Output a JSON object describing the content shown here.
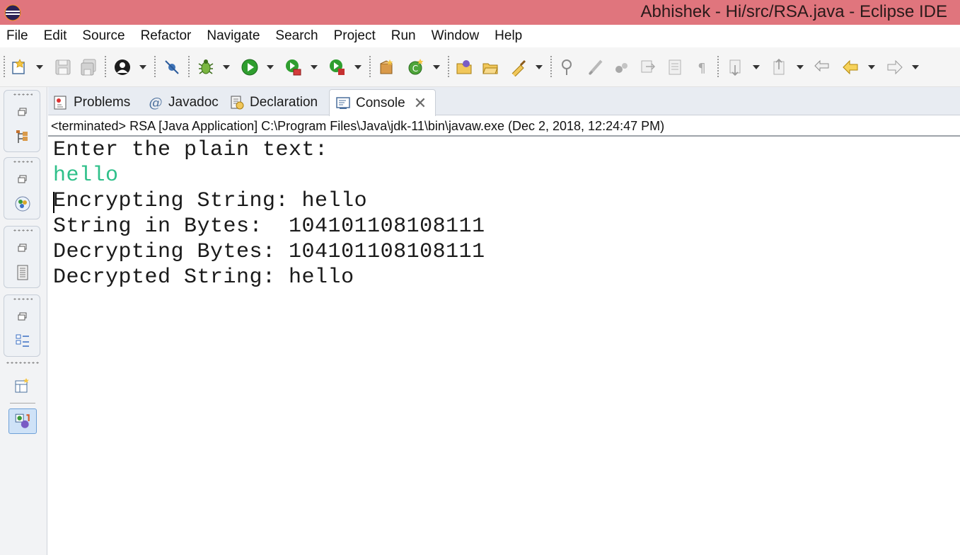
{
  "window": {
    "title": "Abhishek - Hi/src/RSA.java - Eclipse IDE"
  },
  "menu": [
    "File",
    "Edit",
    "Source",
    "Refactor",
    "Navigate",
    "Search",
    "Project",
    "Run",
    "Window",
    "Help"
  ],
  "toolbar_icons": [
    "new-icon",
    "save-icon",
    "save-all-icon",
    "profile-icon",
    "skip-breakpoints-icon",
    "debug-icon",
    "run-icon",
    "coverage-icon",
    "external-tools-icon",
    "new-java-package-icon",
    "new-java-class-icon",
    "open-type-icon",
    "open-task-icon",
    "search-icon",
    "pin-icon",
    "mark-occurrences-icon",
    "annotation-icon",
    "toggle-block-icon",
    "toggle-word-wrap-icon",
    "show-whitespace-icon",
    "next-annotation-icon",
    "previous-annotation-icon",
    "last-edit-location-icon",
    "back-icon",
    "forward-icon"
  ],
  "tabs": [
    {
      "label": "Problems",
      "icon": "problems-icon"
    },
    {
      "label": "Javadoc",
      "icon": "javadoc-icon"
    },
    {
      "label": "Declaration",
      "icon": "declaration-icon"
    },
    {
      "label": "Console",
      "icon": "console-icon",
      "active": true
    }
  ],
  "console": {
    "header": "<terminated> RSA [Java Application] C:\\Program Files\\Java\\jdk-11\\bin\\javaw.exe (Dec 2, 2018, 12:24:47 PM)",
    "lines": [
      {
        "text": "Enter the plain text:",
        "kind": "output"
      },
      {
        "text": "hello",
        "kind": "input"
      },
      {
        "text": "Encrypting String: hello",
        "kind": "output"
      },
      {
        "text": "String in Bytes:  104101108108111",
        "kind": "output"
      },
      {
        "text": "Decrypting Bytes: 104101108108111",
        "kind": "output"
      },
      {
        "text": "Decrypted String: hello",
        "kind": "output"
      }
    ]
  },
  "colors": {
    "title_bar": "#e0757d",
    "input_text": "#2fc08a"
  }
}
